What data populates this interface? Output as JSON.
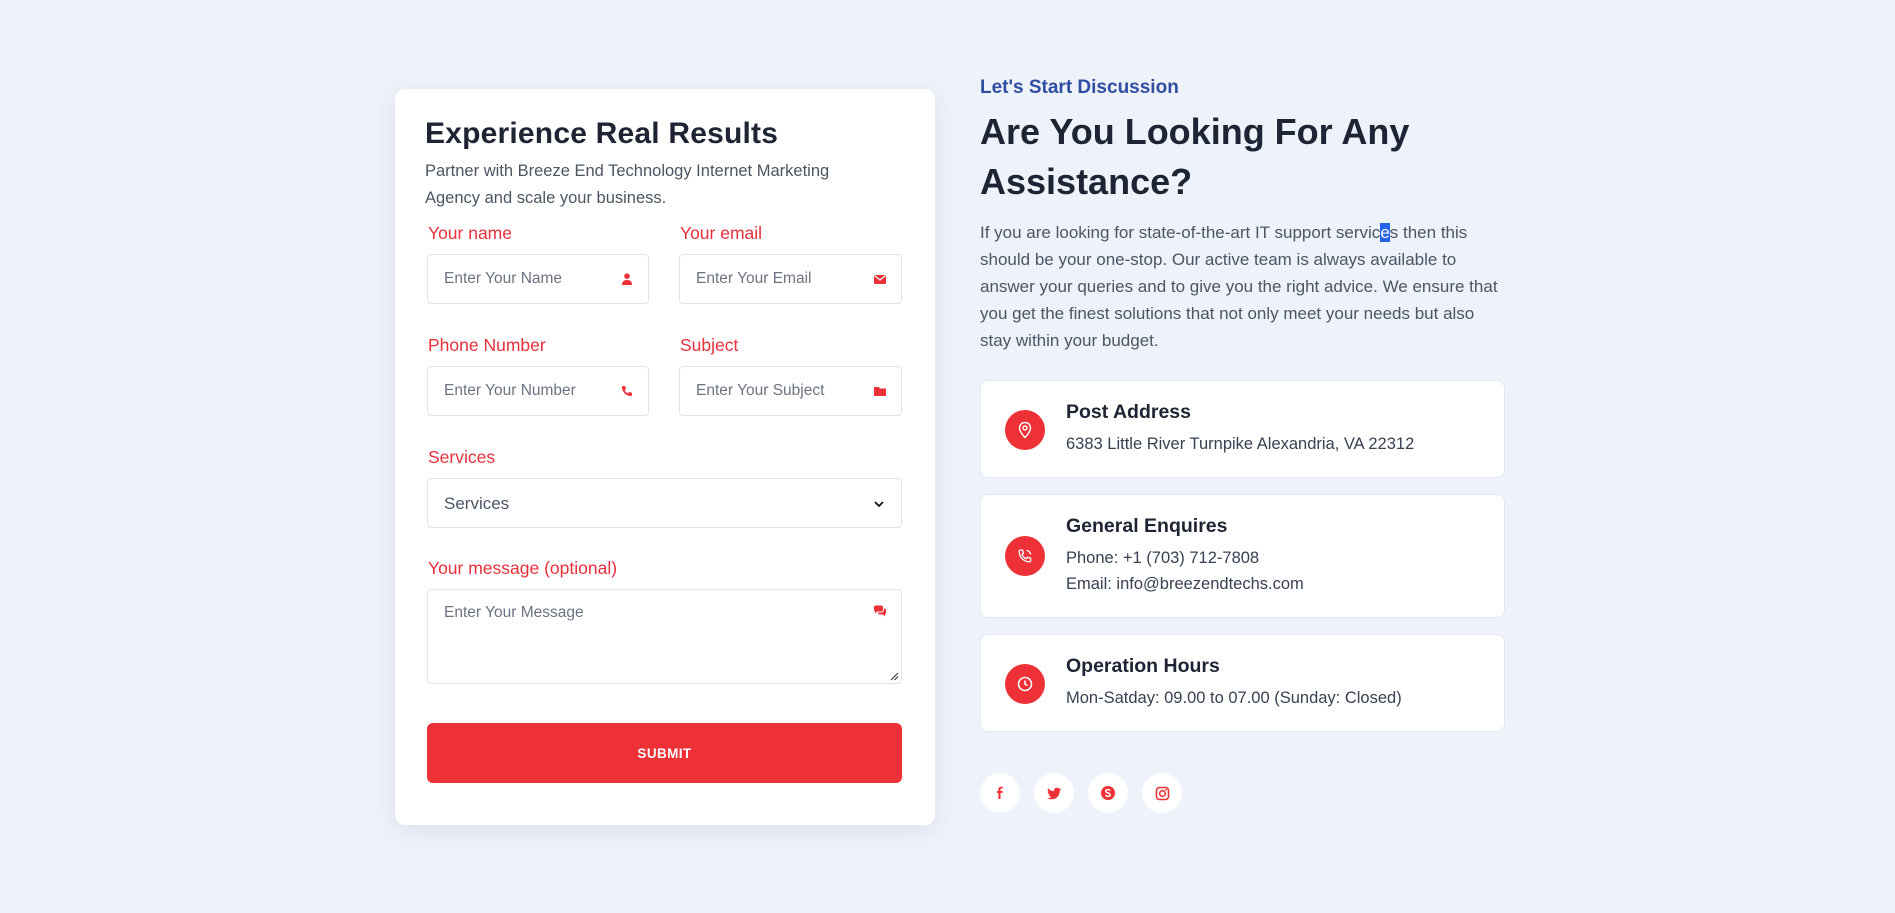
{
  "form": {
    "title": "Experience Real Results",
    "subtitle": "Partner with Breeze End Technology Internet Marketing Agency and scale your business.",
    "name_label": "Your name",
    "name_placeholder": "Enter Your Name",
    "email_label": "Your email",
    "email_placeholder": "Enter Your Email",
    "phone_label": "Phone Number",
    "phone_placeholder": "Enter Your Number",
    "subject_label": "Subject",
    "subject_placeholder": "Enter Your Subject",
    "services_label": "Services",
    "services_selected": "Services",
    "message_label": "Your message (optional)",
    "message_placeholder": "Enter Your Message",
    "submit_label": "SUBMIT"
  },
  "discussion": {
    "eyebrow": "Let's Start Discussion",
    "headline": "Are You Looking For Any Assistance?",
    "intro_before": "If you are looking for state-of-the-art IT support servic",
    "intro_selected": "e",
    "intro_after": "s then this should be your one-stop. Our active team is always available to answer your queries and to give you the right advice. We ensure that you get the finest solutions that not only meet your needs but also stay within your budget."
  },
  "contact_cards": {
    "address": {
      "title": "Post Address",
      "line1": "6383 Little River Turnpike Alexandria, VA 22312",
      "icon": "map-pin-icon"
    },
    "enquires": {
      "title": "General Enquires",
      "line1": "Phone: +1 (703) 712-7808",
      "line2": "Email: info@breezendtechs.com",
      "icon": "phone-icon"
    },
    "hours": {
      "title": "Operation Hours",
      "line1": "Mon-Satday: 09.00 to 07.00 (Sunday: Closed)",
      "icon": "clock-icon"
    }
  },
  "social": [
    "facebook-icon",
    "twitter-icon",
    "skype-icon",
    "instagram-icon"
  ],
  "colors": {
    "accent": "#ee3037",
    "eyebrow": "#2f4ea1",
    "background": "#eef2fa",
    "heading": "#1e2433"
  }
}
